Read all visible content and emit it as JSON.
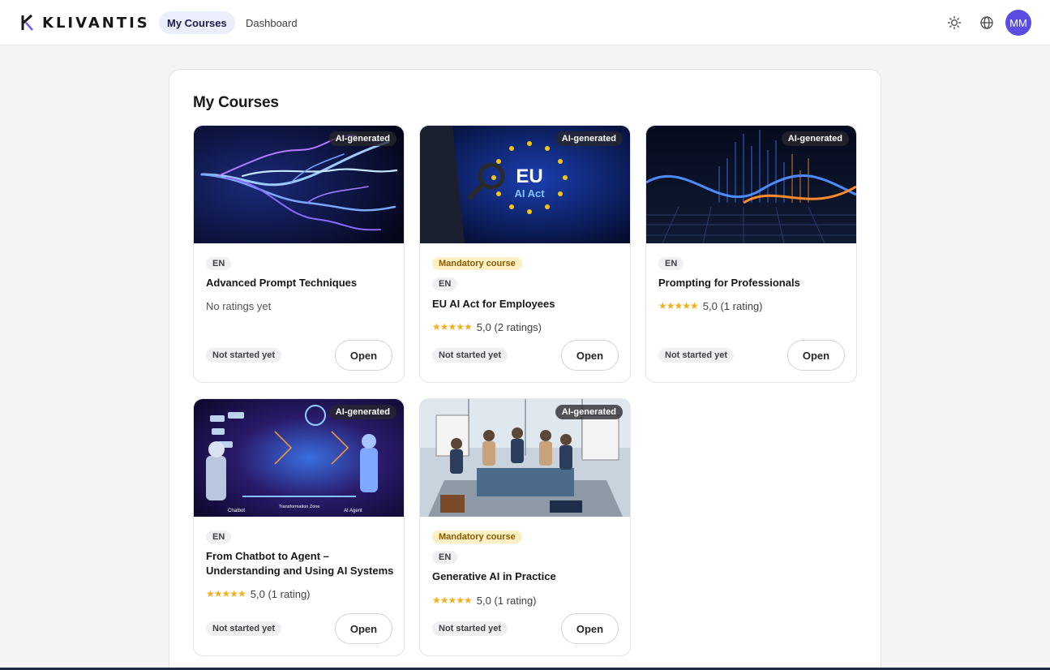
{
  "header": {
    "brand": "KLIVANTIS",
    "tabs": [
      {
        "label": "My Courses",
        "active": true
      },
      {
        "label": "Dashboard",
        "active": false
      }
    ],
    "icons": [
      "sun-icon",
      "globe-icon"
    ],
    "avatar_initials": "MM",
    "colors": {
      "accent": "#5b4de3",
      "active_tab_bg": "#eceefe"
    }
  },
  "main": {
    "title": "My Courses",
    "courses": [
      {
        "title": "Advanced Prompt Techniques",
        "ai_badge": "AI-generated",
        "mandatory": "",
        "language": "EN",
        "rating_text": "",
        "no_rating_text": "No ratings yet",
        "status": "Not started yet",
        "action": "Open"
      },
      {
        "title": "EU AI Act for Employees",
        "ai_badge": "AI-generated",
        "mandatory": "Mandatory course",
        "language": "EN",
        "rating_text": "5,0 (2 ratings)",
        "stars": 5,
        "status": "Not started yet",
        "action": "Open",
        "image_text": {
          "line1": "EU",
          "line2": "AI Act"
        }
      },
      {
        "title": "Prompting for Professionals",
        "ai_badge": "AI-generated",
        "mandatory": "",
        "language": "EN",
        "rating_text": "5,0 (1 rating)",
        "stars": 5,
        "status": "Not started yet",
        "action": "Open"
      },
      {
        "title": "From Chatbot to Agent – Understanding and Using AI Systems",
        "ai_badge": "AI-generated",
        "mandatory": "",
        "language": "EN",
        "rating_text": "5,0 (1 rating)",
        "stars": 5,
        "status": "Not started yet",
        "action": "Open",
        "image_text": {
          "left": "Chatbot",
          "middle": "Transformation Zone",
          "right": "AI Agent"
        }
      },
      {
        "title": "Generative AI in Practice",
        "ai_badge": "AI-generated",
        "mandatory": "Mandatory course",
        "language": "EN",
        "rating_text": "5,0 (1 rating)",
        "stars": 5,
        "status": "Not started yet",
        "action": "Open"
      }
    ]
  }
}
